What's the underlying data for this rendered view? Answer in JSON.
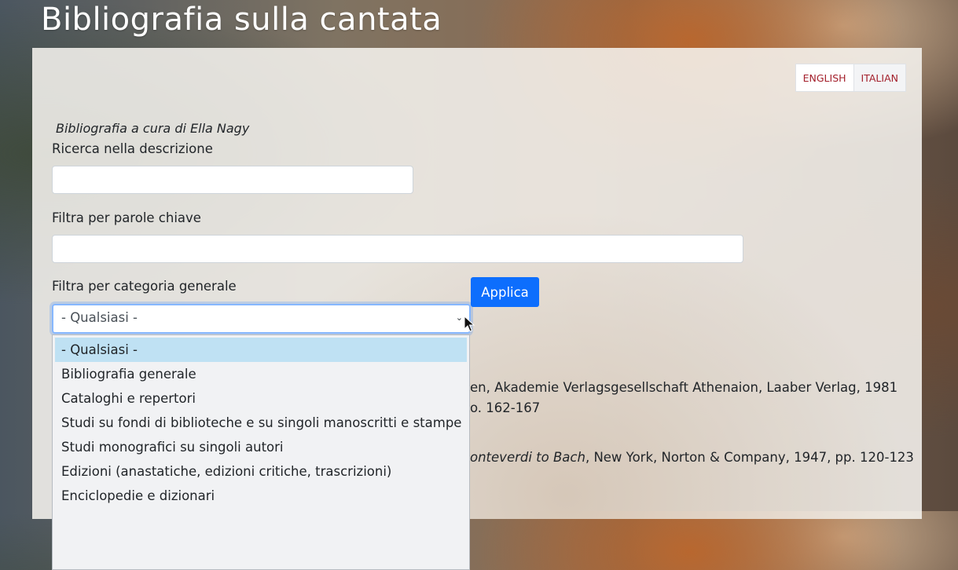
{
  "page": {
    "title": "Bibliografia sulla cantata"
  },
  "language": {
    "english": "ENGLISH",
    "italian": "ITALIAN"
  },
  "credit": "Bibliografia a cura di Ella Nagy",
  "search": {
    "label": "Ricerca nella descrizione",
    "value": "",
    "placeholder": ""
  },
  "keywords": {
    "label": "Filtra per parole chiave",
    "value": "",
    "placeholder": ""
  },
  "category": {
    "label": "Filtra per categoria generale",
    "selected": "- Qualsiasi -",
    "options": [
      "- Qualsiasi -",
      "Bibliografia generale",
      "Cataloghi e repertori",
      "Studi su fondi di biblioteche e su singoli manoscritti e stampe",
      "Studi monografici su singoli autori",
      "Edizioni (anastatiche, edizioni critiche, trascrizioni)",
      "Enciclopedie e dizionari"
    ]
  },
  "apply_label": "Applica",
  "results": {
    "r1_line1": "en, Akademie Verlagsgesellschaft Athenaion, Laaber Verlag, 1981",
    "r1_line2": "o. 162-167",
    "r2_italic": "onteverdi to Bach",
    "r2_rest": ", New York, Norton & Company, 1947, pp. 120-123"
  },
  "colors": {
    "accent": "#0d6efd",
    "lang_link": "#a31f2b",
    "selected_option": "#bfe1f3"
  },
  "icons": {
    "select_arrow": "chevron-down-icon",
    "pointer": "mouse-cursor-icon"
  }
}
